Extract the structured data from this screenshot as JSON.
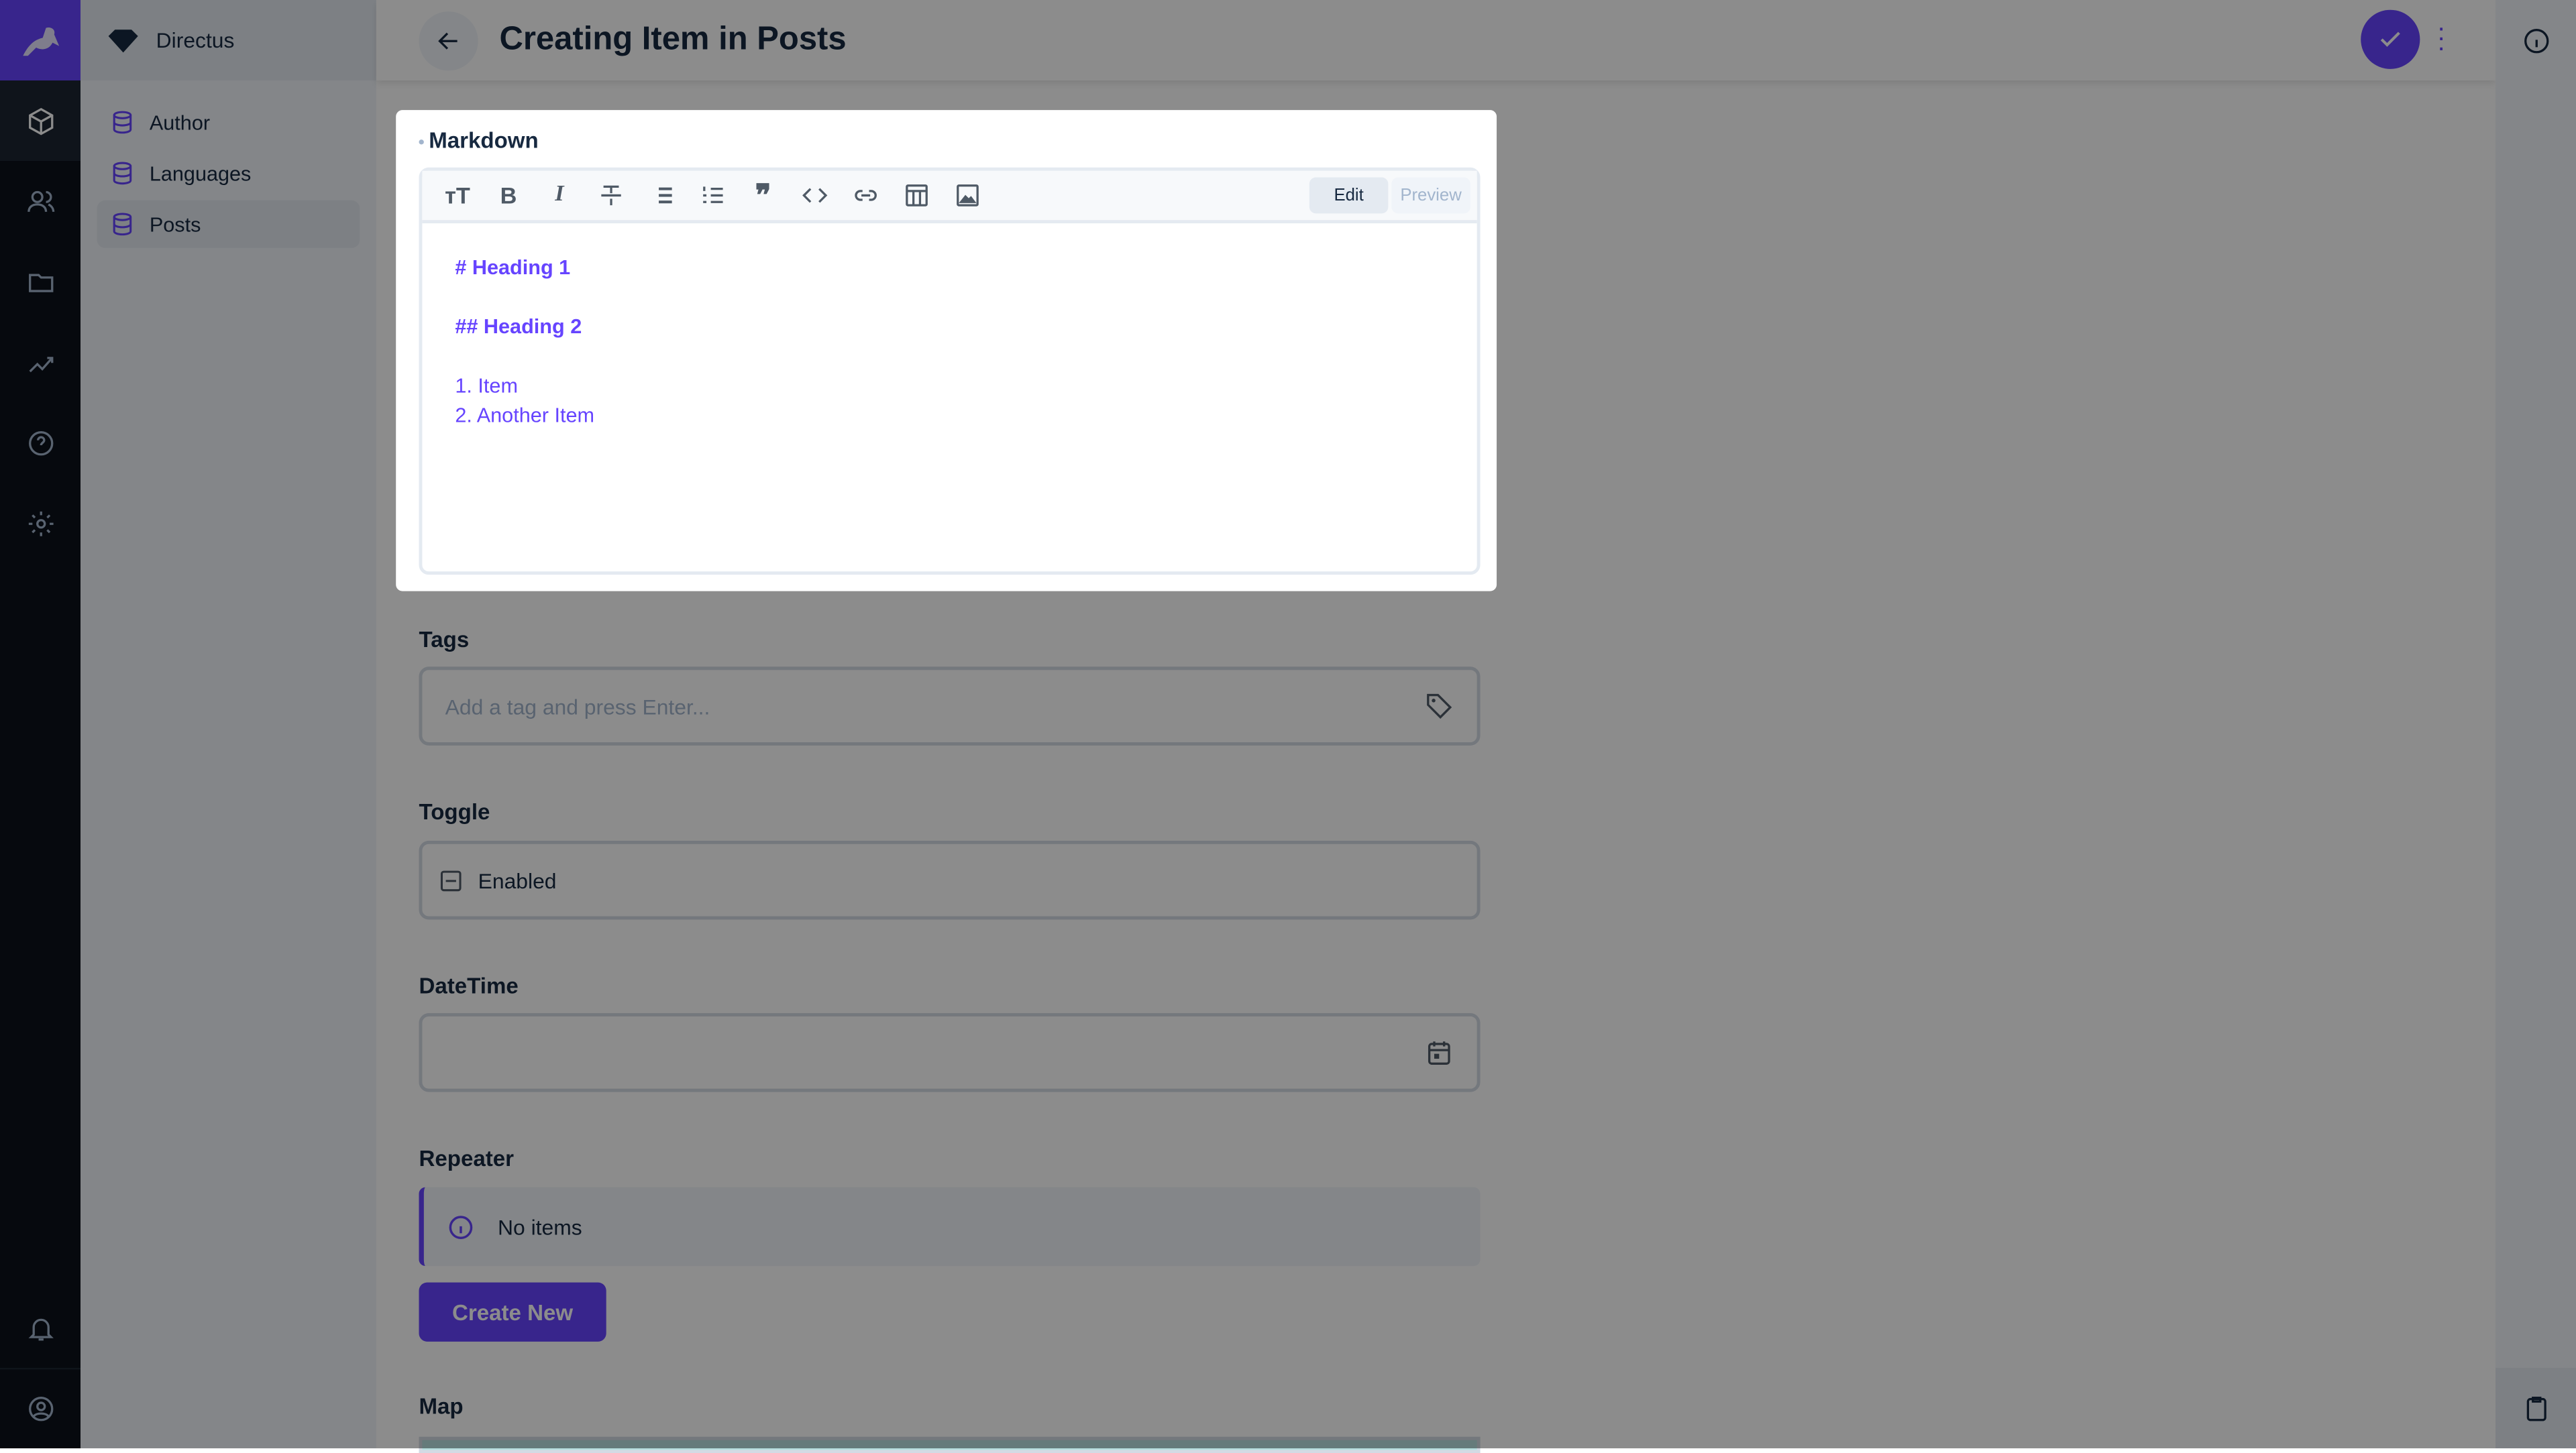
{
  "app": {
    "project_name": "Directus",
    "accent": "#6644ff"
  },
  "nav": {
    "items": [
      {
        "label": "Author",
        "icon": "database-icon"
      },
      {
        "label": "Languages",
        "icon": "database-icon"
      },
      {
        "label": "Posts",
        "icon": "database-icon",
        "active": true
      }
    ]
  },
  "rail": {
    "icons": [
      "content-icon",
      "users-icon",
      "files-icon",
      "insights-icon",
      "help-icon",
      "settings-icon",
      "notifications-icon",
      "user-profile-icon"
    ]
  },
  "header": {
    "title": "Creating Item in Posts"
  },
  "markdown": {
    "label": "Markdown",
    "toolbar": [
      "heading",
      "bold",
      "italic",
      "strikethrough",
      "bullet-list",
      "numbered-list",
      "blockquote",
      "code",
      "link",
      "table",
      "image"
    ],
    "tab_edit": "Edit",
    "tab_preview": "Preview",
    "lines": [
      "# Heading 1",
      "",
      "## Heading 2",
      "",
      "1. Item",
      "2. Another Item"
    ]
  },
  "tags": {
    "label": "Tags",
    "placeholder": "Add a tag and press Enter..."
  },
  "toggle": {
    "label": "Toggle",
    "value_label": "Enabled"
  },
  "datetime": {
    "label": "DateTime",
    "value": ""
  },
  "repeater": {
    "label": "Repeater",
    "empty_text": "No items",
    "create_label": "Create New"
  },
  "map": {
    "label": "Map"
  }
}
